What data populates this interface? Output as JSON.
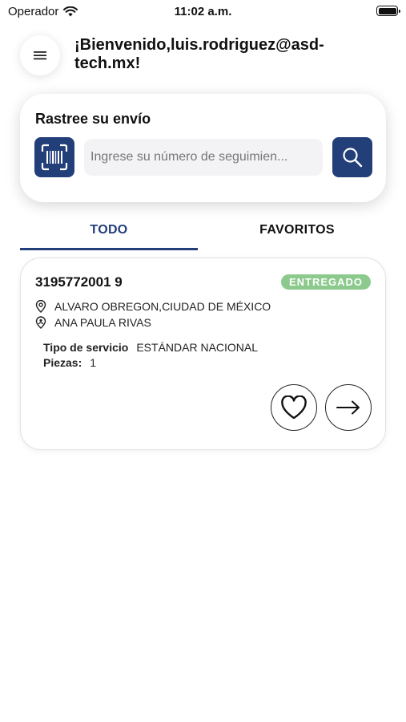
{
  "status_bar": {
    "carrier": "Operador",
    "time": "11:02 a.m."
  },
  "header": {
    "welcome": "¡Bienvenido,luis.rodriguez@asd-tech.mx!"
  },
  "tracker": {
    "title": "Rastree su envío",
    "placeholder": "Ingrese su número de seguimien..."
  },
  "tabs": [
    {
      "label": "TODO",
      "active": true
    },
    {
      "label": "FAVORITOS",
      "active": false
    }
  ],
  "shipment": {
    "tracking_number": "3195772001 9",
    "status": "ENTREGADO",
    "status_color": "#8cc98c",
    "address": "ALVARO OBREGON,CIUDAD DE MÉXICO",
    "recipient": "ANA PAULA RIVAS",
    "service_label": "Tipo de servicio",
    "service_value": "ESTÁNDAR NACIONAL",
    "pieces_label": "Piezas:",
    "pieces_value": "1"
  },
  "colors": {
    "primary": "#233f7a",
    "status_green": "#8cc98c"
  },
  "icons": [
    "wifi-icon",
    "battery-icon",
    "menu-icon",
    "barcode-scan-icon",
    "search-icon",
    "location-pin-icon",
    "person-pin-icon",
    "heart-icon",
    "arrow-right-icon"
  ]
}
